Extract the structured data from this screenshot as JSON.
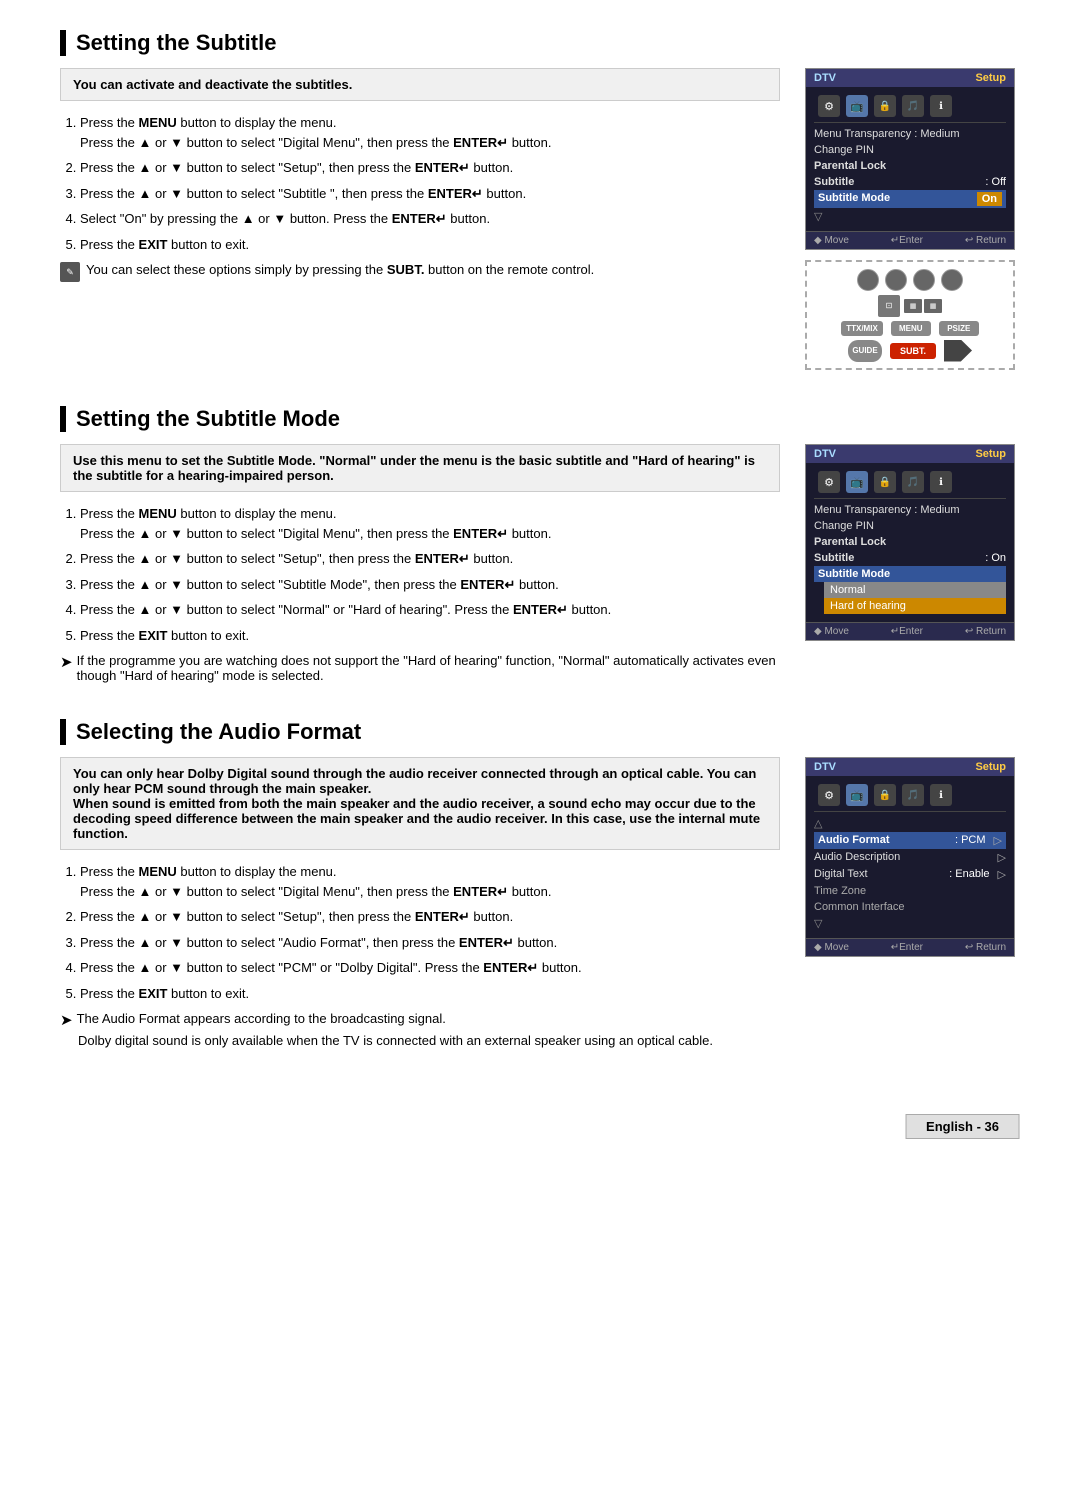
{
  "sections": [
    {
      "id": "setting-subtitle",
      "title": "Setting the Subtitle",
      "infoText": "You can activate and deactivate the subtitles.",
      "steps": [
        {
          "parts": [
            {
              "text": "Press the ",
              "bold": false
            },
            {
              "text": "MENU",
              "bold": true
            },
            {
              "text": " button to display the menu.",
              "bold": false
            },
            {
              "text": "\nPress the ▲ or ▼ button to select \"Digital Menu\", then press the ",
              "bold": false
            },
            {
              "text": "ENTER",
              "bold": true
            },
            {
              "text": "↵ button.",
              "bold": false
            }
          ]
        },
        {
          "parts": [
            {
              "text": "Press the ▲ or ▼ button to select \"Setup\", then press the ",
              "bold": false
            },
            {
              "text": "ENTER",
              "bold": true
            },
            {
              "text": "↵ button.",
              "bold": false
            }
          ]
        },
        {
          "parts": [
            {
              "text": "Press the ▲ or ▼ button to select \"Subtitle \", then press the ",
              "bold": false
            },
            {
              "text": "ENTER",
              "bold": true
            },
            {
              "text": "↵ button.",
              "bold": false
            }
          ]
        },
        {
          "parts": [
            {
              "text": "Select \"On\" by pressing the ▲ or ▼ button. Press the ",
              "bold": false
            },
            {
              "text": "ENTER",
              "bold": true
            },
            {
              "text": "↵ button.",
              "bold": false
            }
          ]
        },
        {
          "parts": [
            {
              "text": "Press the ",
              "bold": false
            },
            {
              "text": "EXIT",
              "bold": true
            },
            {
              "text": " button to exit.",
              "bold": false
            }
          ]
        }
      ],
      "noteIcon": true,
      "noteText": "You can select these options simply by pressing the SUBT. button on the remote control.",
      "noteBold": [
        "SUBT."
      ],
      "menu": {
        "header": {
          "dtv": "DTV",
          "setup": "Setup"
        },
        "rows": [
          {
            "icon": "🔧",
            "label": "Menu Transparency : Medium"
          },
          {
            "icon": "",
            "label": "Change PIN"
          },
          {
            "icon": "🔒",
            "label": "Parental Lock"
          },
          {
            "icon": "",
            "label": "Subtitle",
            "value": "Off",
            "valueHighlight": false
          },
          {
            "icon": "",
            "label": "Subtitle Mode",
            "value": "On",
            "valueHighlight": true
          },
          {
            "icon": "",
            "label": "▽"
          }
        ],
        "footer": [
          "◆ Move",
          "↵Enter",
          "↩ Return"
        ]
      },
      "showRemote": true
    },
    {
      "id": "setting-subtitle-mode",
      "title": "Setting the Subtitle Mode",
      "infoLines": [
        "Use this menu to set the Subtitle Mode. \"Normal\" under the menu is the basic subtitle and \"Hard of hearing\" is the subtitle for a hearing-impaired person."
      ],
      "steps": [
        {
          "parts": [
            {
              "text": "Press the ",
              "bold": false
            },
            {
              "text": "MENU",
              "bold": true
            },
            {
              "text": " button to display the menu.",
              "bold": false
            },
            {
              "text": "\nPress the ▲ or ▼ button to select \"Digital Menu\", then press the ",
              "bold": false
            },
            {
              "text": "ENTER",
              "bold": true
            },
            {
              "text": "↵ button.",
              "bold": false
            }
          ]
        },
        {
          "parts": [
            {
              "text": "Press the ▲ or ▼ button to select \"Setup\", then press the ",
              "bold": false
            },
            {
              "text": "ENTER",
              "bold": true
            },
            {
              "text": "↵ button.",
              "bold": false
            }
          ]
        },
        {
          "parts": [
            {
              "text": "Press the ▲ or ▼ button to select \"Subtitle Mode\", then press the ",
              "bold": false
            },
            {
              "text": "ENTER",
              "bold": true
            },
            {
              "text": "↵ button.",
              "bold": false
            }
          ]
        },
        {
          "parts": [
            {
              "text": "Press the ▲ or ▼ button to select \"Normal\" or \"Hard of hearing\". Press the ",
              "bold": false
            },
            {
              "text": "ENTER",
              "bold": true
            },
            {
              "text": "↵ button.",
              "bold": false
            }
          ]
        },
        {
          "parts": [
            {
              "text": "Press the ",
              "bold": false
            },
            {
              "text": "EXIT",
              "bold": true
            },
            {
              "text": " button to exit.",
              "bold": false
            }
          ]
        }
      ],
      "noteArrow": true,
      "noteText": "If the programme you are watching does not support the \"Hard of hearing\" function, \"Normal\" automatically activates even though \"Hard of hearing\" mode is selected.",
      "menu": {
        "header": {
          "dtv": "DTV",
          "setup": "Setup"
        },
        "rows": [
          {
            "icon": "🔧",
            "label": "Menu Transparency : Medium"
          },
          {
            "icon": "",
            "label": "Change PIN"
          },
          {
            "icon": "🔒",
            "label": "Parental Lock"
          },
          {
            "icon": "",
            "label": "Subtitle",
            "value": ": On",
            "valueHighlight": false
          },
          {
            "icon": "",
            "label": "Subtitle Mode",
            "value": "",
            "valueHighlight": false,
            "dropdown": true
          }
        ],
        "dropdownOptions": [
          "Normal",
          "Hard of hearing"
        ],
        "footer": [
          "◆ Move",
          "↵Enter",
          "↩ Return"
        ]
      }
    },
    {
      "id": "selecting-audio-format",
      "title": "Selecting the Audio Format",
      "infoLines": [
        "You can only hear Dolby Digital sound through the audio receiver connected through an optical cable. You can only hear PCM sound through the main speaker.",
        "When sound is emitted from both the main speaker and the audio receiver, a sound echo may occur due to the decoding speed difference between the main speaker and the audio receiver. In this case, use the internal mute function."
      ],
      "infoBold": [
        "PCM sound through the main speaker.",
        "You can only hear Dolby Digital sound through the audio receiver connected through an optical cable. You can only hear"
      ],
      "steps": [
        {
          "parts": [
            {
              "text": "Press the ",
              "bold": false
            },
            {
              "text": "MENU",
              "bold": true
            },
            {
              "text": " button to display the menu.",
              "bold": false
            },
            {
              "text": "\nPress the ▲ or ▼ button to select \"Digital Menu\", then press the ",
              "bold": false
            },
            {
              "text": "ENTER",
              "bold": true
            },
            {
              "text": "↵ button.",
              "bold": false
            }
          ]
        },
        {
          "parts": [
            {
              "text": "Press the ▲ or ▼ button to select \"Setup\", then press the ",
              "bold": false
            },
            {
              "text": "ENTER",
              "bold": true
            },
            {
              "text": "↵ button.",
              "bold": false
            }
          ]
        },
        {
          "parts": [
            {
              "text": "Press the ▲ or ▼ button to select \"Audio Format\", then press the ",
              "bold": false
            },
            {
              "text": "ENTER",
              "bold": true
            },
            {
              "text": "↵ button.",
              "bold": false
            }
          ]
        },
        {
          "parts": [
            {
              "text": "Press the ▲ or ▼ button to select \"PCM\" or \"Dolby Digital\". Press the ",
              "bold": false
            },
            {
              "text": "ENTER",
              "bold": true
            },
            {
              "text": "↵ button.",
              "bold": false
            }
          ]
        },
        {
          "parts": [
            {
              "text": "Press the ",
              "bold": false
            },
            {
              "text": "EXIT",
              "bold": true
            },
            {
              "text": " button to exit.",
              "bold": false
            }
          ]
        }
      ],
      "noteArrow": true,
      "noteLines": [
        "The Audio Format appears according to the broadcasting signal.",
        "Dolby digital sound is only available when the TV is connected with an external speaker using an optical cable."
      ],
      "menu": {
        "header": {
          "dtv": "DTV",
          "setup": "Setup"
        },
        "rows": [
          {
            "icon": "",
            "label": "△"
          },
          {
            "icon": "",
            "label": "Audio Format",
            "value": ": PCM",
            "hasArrow": true
          },
          {
            "icon": "",
            "label": "Audio Description",
            "hasArrow": true
          },
          {
            "icon": "",
            "label": "Digital Text",
            "value": ": Enable",
            "hasArrow": true
          },
          {
            "icon": "",
            "label": "Time Zone"
          },
          {
            "icon": "",
            "label": "Common Interface"
          },
          {
            "icon": "",
            "label": "▽"
          }
        ],
        "footer": [
          "◆ Move",
          "↵Enter",
          "↩ Return"
        ]
      }
    }
  ],
  "footer": {
    "text": "English - 36"
  }
}
